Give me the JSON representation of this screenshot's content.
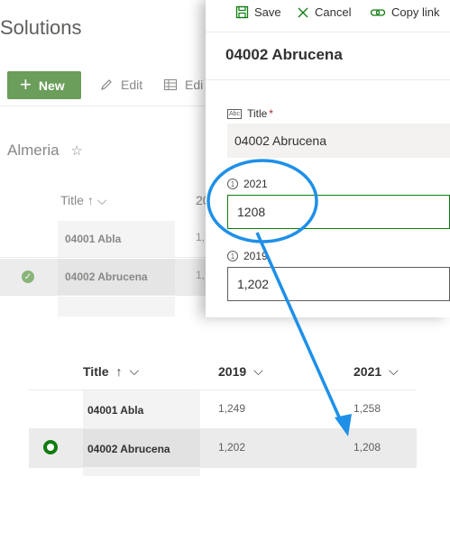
{
  "background": {
    "site_title": "Solutions",
    "toolbar": {
      "new_label": "New",
      "edit_label": "Edit",
      "grid_label": "Edi"
    },
    "list_name": "Almeria",
    "columns": {
      "title": "Title",
      "year_partial": "20"
    },
    "rows": [
      {
        "title": "04001 Abla",
        "value": "1,"
      },
      {
        "title": "04002 Abrucena",
        "value": "1,"
      }
    ]
  },
  "panel": {
    "commands": {
      "save": "Save",
      "cancel": "Cancel",
      "copy_link": "Copy link"
    },
    "item_title": "04002 Abrucena",
    "fields": {
      "title_label": "Title",
      "title_required_mark": "*",
      "title_value": "04002 Abrucena",
      "f2021_label": "2021",
      "f2021_value": "1208",
      "f2019_label": "2019",
      "f2019_value": "1,202"
    }
  },
  "table": {
    "columns": {
      "title": "Title",
      "c2019": "2019",
      "c2021": "2021"
    },
    "rows": [
      {
        "title": "04001 Abla",
        "c2019": "1,249",
        "c2021": "1,258",
        "selected": false
      },
      {
        "title": "04002 Abrucena",
        "c2019": "1,202",
        "c2021": "1,208",
        "selected": true
      }
    ]
  },
  "annotation": {
    "highlight_color": "#1e90e8"
  }
}
